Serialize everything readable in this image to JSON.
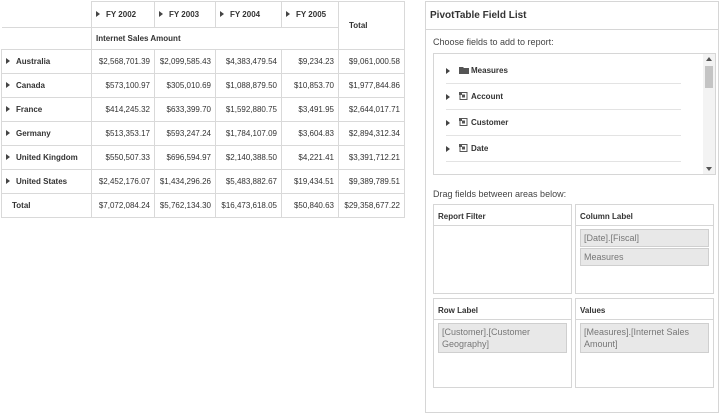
{
  "grid": {
    "column_headers": [
      {
        "label": "FY 2002",
        "expandable": true
      },
      {
        "label": "FY 2003",
        "expandable": true
      },
      {
        "label": "FY 2004",
        "expandable": true
      },
      {
        "label": "FY 2005",
        "expandable": true
      },
      {
        "label": "Total",
        "expandable": false
      }
    ],
    "measure_label": "Internet Sales Amount",
    "rows": [
      {
        "label": "Australia",
        "values": [
          "$2,568,701.39",
          "$2,099,585.43",
          "$4,383,479.54",
          "$9,234.23",
          "$9,061,000.58"
        ]
      },
      {
        "label": "Canada",
        "values": [
          "$573,100.97",
          "$305,010.69",
          "$1,088,879.50",
          "$10,853.70",
          "$1,977,844.86"
        ]
      },
      {
        "label": "France",
        "values": [
          "$414,245.32",
          "$633,399.70",
          "$1,592,880.75",
          "$3,491.95",
          "$2,644,017.71"
        ]
      },
      {
        "label": "Germany",
        "values": [
          "$513,353.17",
          "$593,247.24",
          "$1,784,107.09",
          "$3,604.83",
          "$2,894,312.34"
        ]
      },
      {
        "label": "United Kingdom",
        "values": [
          "$550,507.33",
          "$696,594.97",
          "$2,140,388.50",
          "$4,221.41",
          "$3,391,712.21"
        ]
      },
      {
        "label": "United States",
        "values": [
          "$2,452,176.07",
          "$1,434,296.26",
          "$5,483,882.67",
          "$19,434.51",
          "$9,389,789.51"
        ]
      }
    ],
    "total_row": {
      "label": "Total",
      "values": [
        "$7,072,084.24",
        "$5,762,134.30",
        "$16,473,618.05",
        "$50,840.63",
        "$29,358,677.22"
      ]
    }
  },
  "field_list": {
    "title": "PivotTable Field List",
    "choose_label": "Choose fields to add to report:",
    "tree_items": [
      {
        "label": "Measures",
        "icon": "folder-icon"
      },
      {
        "label": "Account",
        "icon": "dimension-icon"
      },
      {
        "label": "Customer",
        "icon": "dimension-icon"
      },
      {
        "label": "Date",
        "icon": "dimension-icon"
      }
    ],
    "drag_label": "Drag fields between areas below:",
    "areas": {
      "report_filter": {
        "title": "Report Filter",
        "items": []
      },
      "column_label": {
        "title": "Column Label",
        "items": [
          "[Date].[Fiscal]",
          "Measures"
        ]
      },
      "row_label": {
        "title": "Row Label",
        "items": [
          "[Customer].[Customer Geography]"
        ]
      },
      "values": {
        "title": "Values",
        "items": [
          "[Measures].[Internet Sales Amount]"
        ]
      }
    }
  },
  "colors": {
    "border": "#d9d9d9",
    "item_bg": "#e8e8e8",
    "text": "#333333",
    "muted_text": "#777777"
  }
}
